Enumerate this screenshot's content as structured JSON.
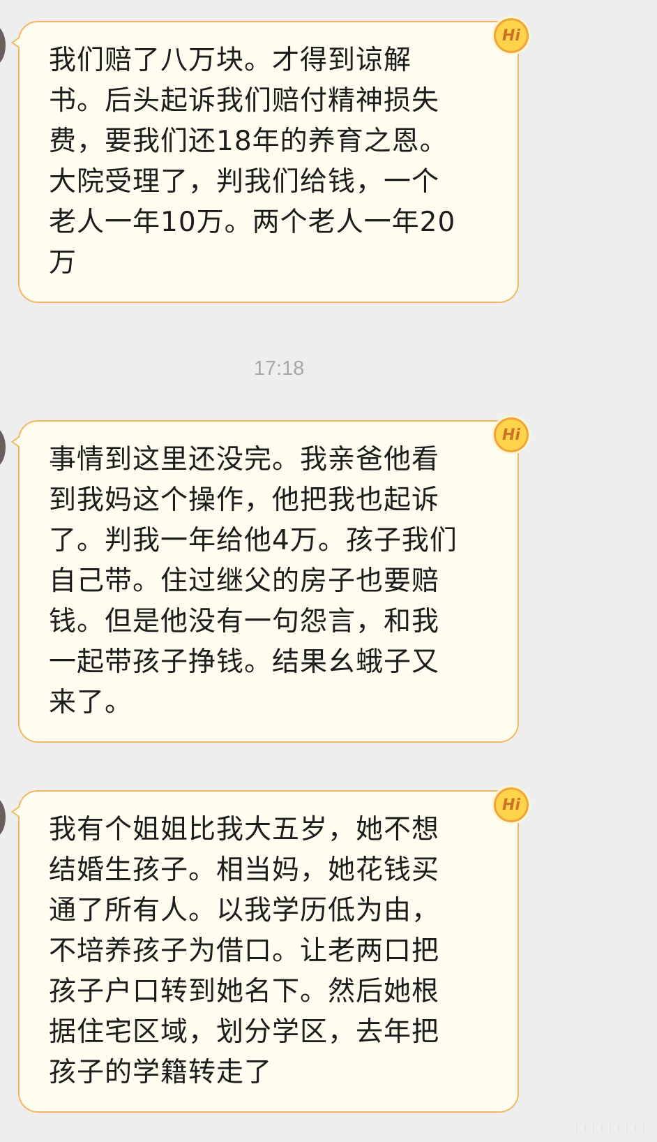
{
  "messages": [
    {
      "text": "我们赔了八万块。才得到谅解\n书。后头起诉我们赔付精神损失\n费，要我们还18年的养育之恩。\n大院受理了，判我们给钱，一个\n老人一年10万。两个老人一年20\n万",
      "badge": "Hi"
    },
    {
      "text": "事情到这里还没完。我亲爸他看\n到我妈这个操作，他把我也起诉\n了。判我一年给他4万。孩子我们\n自己带。住过继父的房子也要赔\n钱。但是他没有一句怨言，和我\n一起带孩子挣钱。结果幺蛾子又\n来了。",
      "badge": "Hi"
    },
    {
      "text": "我有个姐姐比我大五岁，她不想\n结婚生孩子。相当妈，她花钱买\n通了所有人。以我学历低为由，\n不培养孩子为借口。让老两口把\n孩子户口转到她名下。然后她根\n据住宅区域，划分学区，去年把\n孩子的学籍转走了",
      "badge": "Hi"
    }
  ],
  "timestamp": "17:18",
  "colors": {
    "background": "#eeeeee",
    "bubble_fill": "#fefdf0",
    "bubble_border": "#f2b760",
    "badge_fill": "#ffd44a",
    "text": "#1c1c1c",
    "timestamp": "#a7a7a7"
  }
}
